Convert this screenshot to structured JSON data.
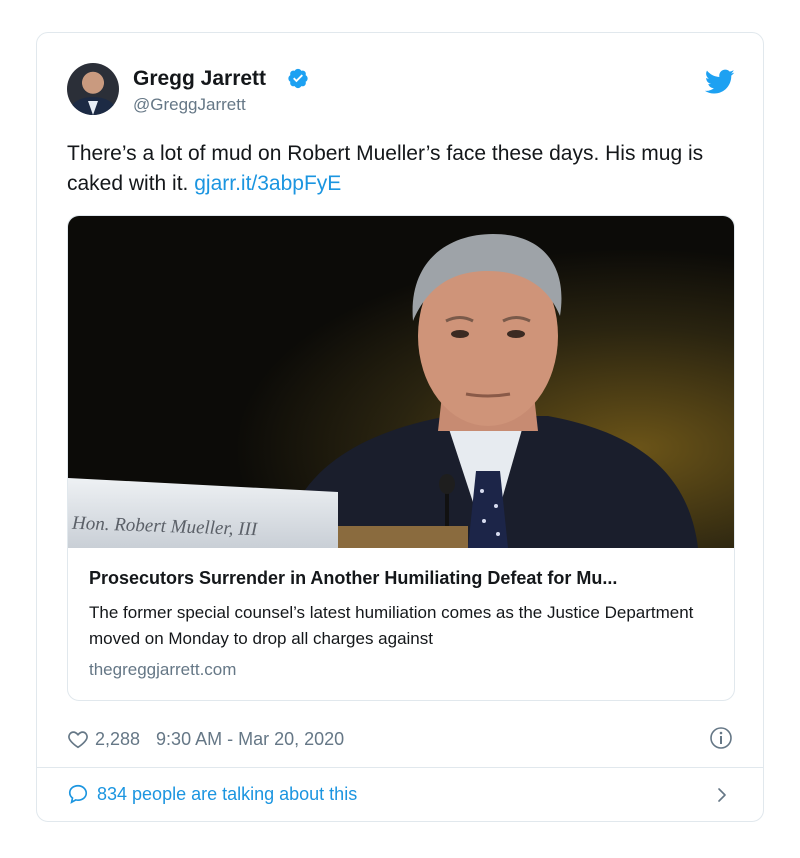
{
  "author": {
    "name": "Gregg Jarrett",
    "handle": "@GreggJarrett",
    "verified": true
  },
  "tweet": {
    "text_before_link": "There’s a lot of mud on Robert Mueller’s face these days.  His mug is caked with it. ",
    "link_text": "gjarr.it/3abpFyE"
  },
  "link_card": {
    "image_nameplate": "Hon. Robert Mueller, III",
    "title": "Prosecutors Surrender in Another Humiliating Defeat for Mu...",
    "description": "The former special counsel’s latest humiliation comes as the Justice Department moved on Monday to drop all charges against",
    "domain": "thegreggjarrett.com"
  },
  "meta": {
    "likes": "2,288",
    "timestamp": "9:30 AM - Mar 20, 2020"
  },
  "footer": {
    "talking_text": "834 people are talking about this"
  },
  "colors": {
    "accent": "#1b95e0",
    "muted": "#657786",
    "border": "#e1e8ed"
  },
  "icons": {
    "verified": "verified-badge-icon",
    "bird": "twitter-bird-icon",
    "heart": "heart-icon",
    "info": "info-icon",
    "bubble": "speech-bubble-icon",
    "chevron": "chevron-right-icon"
  }
}
